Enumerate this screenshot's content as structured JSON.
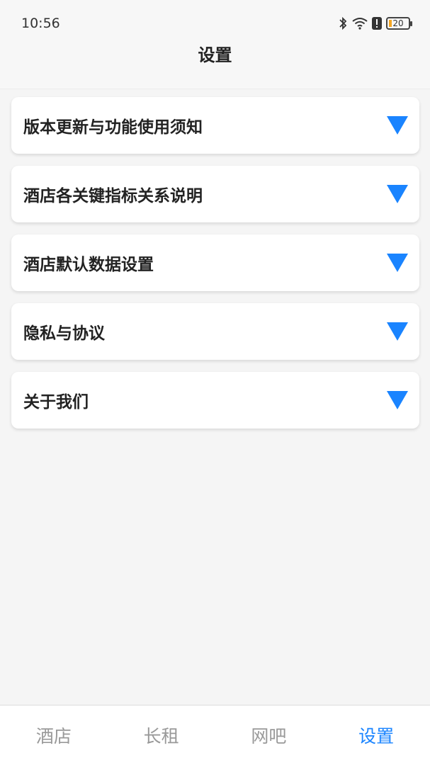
{
  "status": {
    "time": "10:56",
    "icons": [
      "bluetooth-icon",
      "wifi-icon",
      "alert-icon"
    ],
    "battery": "20"
  },
  "header": {
    "title": "设置"
  },
  "settings": {
    "items": [
      {
        "label": "版本更新与功能使用须知"
      },
      {
        "label": "酒店各关键指标关系说明"
      },
      {
        "label": "酒店默认数据设置"
      },
      {
        "label": "隐私与协议"
      },
      {
        "label": "关于我们"
      }
    ]
  },
  "tabs": [
    {
      "label": "酒店",
      "active": false
    },
    {
      "label": "长租",
      "active": false
    },
    {
      "label": "网吧",
      "active": false
    },
    {
      "label": "设置",
      "active": true
    }
  ],
  "colors": {
    "accent": "#1a84ff",
    "inactive_tab": "#999999",
    "background": "#f5f5f5"
  }
}
